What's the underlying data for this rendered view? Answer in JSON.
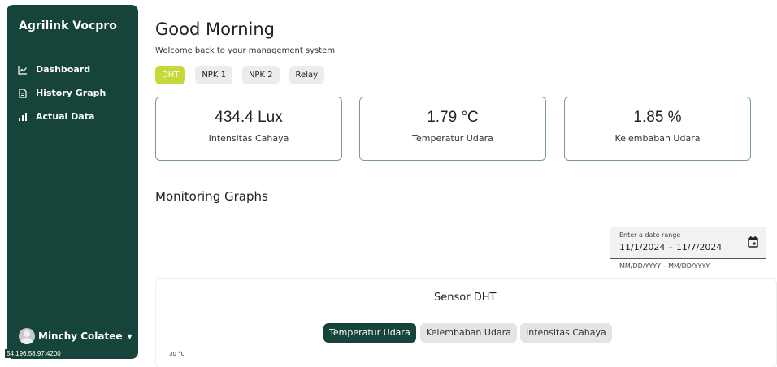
{
  "sidebar": {
    "brand": "Agrilink Vocpro",
    "items": [
      {
        "label": "Dashboard",
        "icon": "line-chart-icon"
      },
      {
        "label": "History Graph",
        "icon": "document-icon"
      },
      {
        "label": "Actual Data",
        "icon": "bar-chart-icon"
      }
    ],
    "user": "Minchy Colatee"
  },
  "status_url": "54.196.58.97:4200",
  "header": {
    "greeting": "Good Morning",
    "welcome": "Welcome back to your management system"
  },
  "tabs": [
    "DHT",
    "NPK 1",
    "NPK 2",
    "Relay"
  ],
  "active_tab": "DHT",
  "cards": [
    {
      "value": "434.4 Lux",
      "label": "Intensitas Cahaya"
    },
    {
      "value": "1.79 °C",
      "label": "Temperatur Udara"
    },
    {
      "value": "1.85 %",
      "label": "Kelembaban Udara"
    }
  ],
  "monitoring": {
    "title": "Monitoring Graphs",
    "date_range": {
      "label": "Enter a date range",
      "start": "11/1/2024",
      "end": "11/7/2024",
      "separator": "–",
      "hint": "MM/DD/YYYY – MM/DD/YYYY"
    },
    "panel_title": "Sensor DHT",
    "chips": [
      "Temperatur Udara",
      "Kelembaban Udara",
      "Intensitas Cahaya"
    ],
    "active_chip": "Temperatur Udara",
    "y_axis_top": "30 °C"
  },
  "colors": {
    "sidebar_bg": "#16443b",
    "accent_tab": "#c7d93a",
    "card_border": "#7a9a94"
  }
}
